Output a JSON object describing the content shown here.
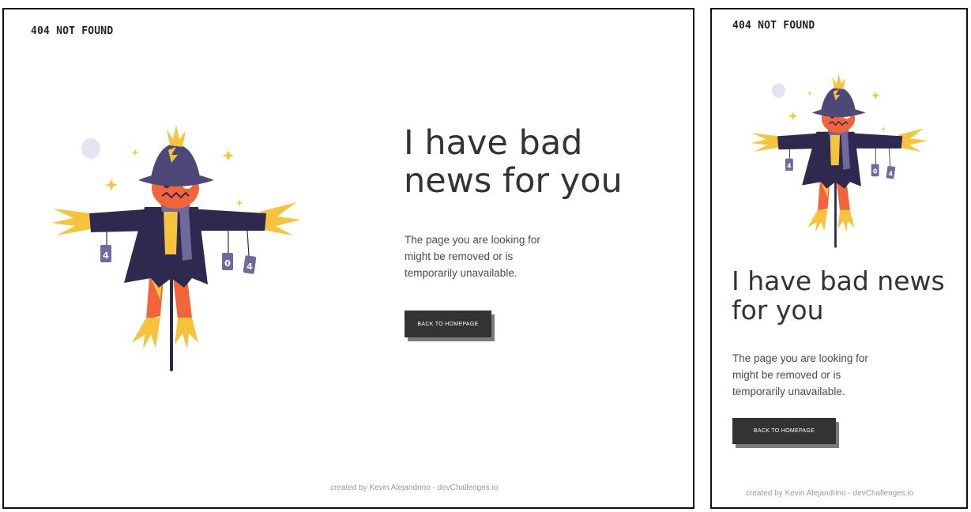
{
  "brand": "404 NOT FOUND",
  "headline": "I have bad news for you",
  "message": "The page you are looking for might be removed or is temporarily unavailable.",
  "button_label": "BACK TO HOMEPAGE",
  "credit": "created by Kevin Alejandrino - devChallenges.io",
  "illustration": {
    "name": "scarecrow-illustration",
    "can_labels": [
      "4",
      "0",
      "4"
    ]
  },
  "colors": {
    "hat": "#4e4878",
    "face": "#f2653a",
    "coat": "#2e2a4f",
    "straw": "#f6c33e",
    "scarf": "#6f6a9e",
    "moon": "#e3e3f3",
    "button": "#333333",
    "button_shadow": "#7b7b7b"
  }
}
